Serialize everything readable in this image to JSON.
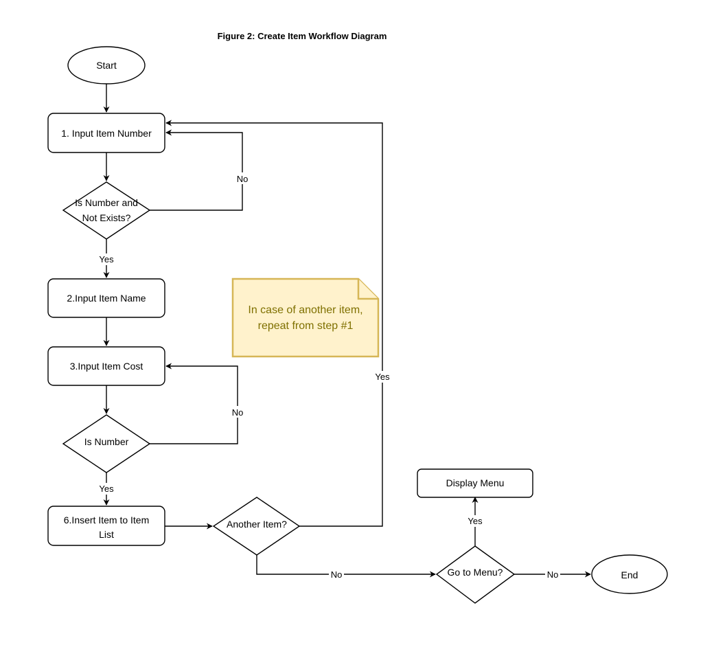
{
  "title": "Figure 2: Create Item Workflow Diagram",
  "nodes": {
    "start": {
      "type": "terminator",
      "lines": [
        "Start"
      ]
    },
    "input_number": {
      "type": "process",
      "lines": [
        "1. Input Item Number"
      ]
    },
    "check_number_exists": {
      "type": "decision",
      "lines": [
        "Is Number and",
        "Not Exists?"
      ]
    },
    "input_name": {
      "type": "process",
      "lines": [
        "2.Input Item Name"
      ]
    },
    "input_cost": {
      "type": "process",
      "lines": [
        "3.Input Item Cost"
      ]
    },
    "check_is_number": {
      "type": "decision",
      "lines": [
        "Is Number"
      ]
    },
    "insert_item": {
      "type": "process",
      "lines": [
        "6.Insert Item to Item",
        "List"
      ]
    },
    "another_item": {
      "type": "decision",
      "lines": [
        "Another Item?"
      ]
    },
    "go_to_menu": {
      "type": "decision",
      "lines": [
        "Go to Menu?"
      ]
    },
    "display_menu": {
      "type": "process",
      "lines": [
        "Display Menu"
      ]
    },
    "end": {
      "type": "terminator",
      "lines": [
        "End"
      ]
    }
  },
  "note": {
    "lines": [
      "In case of another item,",
      "repeat from step #1"
    ],
    "fill_color": "#fff2cc",
    "border_color": "#d6b656",
    "text_color": "#7f7000"
  },
  "edges": [
    {
      "from": "start",
      "to": "input_number",
      "label": ""
    },
    {
      "from": "input_number",
      "to": "check_number_exists",
      "label": ""
    },
    {
      "from": "check_number_exists",
      "to": "input_number",
      "label": "No"
    },
    {
      "from": "check_number_exists",
      "to": "input_name",
      "label": "Yes"
    },
    {
      "from": "input_name",
      "to": "input_cost",
      "label": ""
    },
    {
      "from": "input_cost",
      "to": "check_is_number",
      "label": ""
    },
    {
      "from": "check_is_number",
      "to": "input_cost",
      "label": "No"
    },
    {
      "from": "check_is_number",
      "to": "insert_item",
      "label": "Yes"
    },
    {
      "from": "insert_item",
      "to": "another_item",
      "label": ""
    },
    {
      "from": "another_item",
      "to": "input_number",
      "label": "Yes"
    },
    {
      "from": "another_item",
      "to": "go_to_menu",
      "label": "No"
    },
    {
      "from": "go_to_menu",
      "to": "display_menu",
      "label": "Yes"
    },
    {
      "from": "go_to_menu",
      "to": "end",
      "label": "No"
    }
  ]
}
